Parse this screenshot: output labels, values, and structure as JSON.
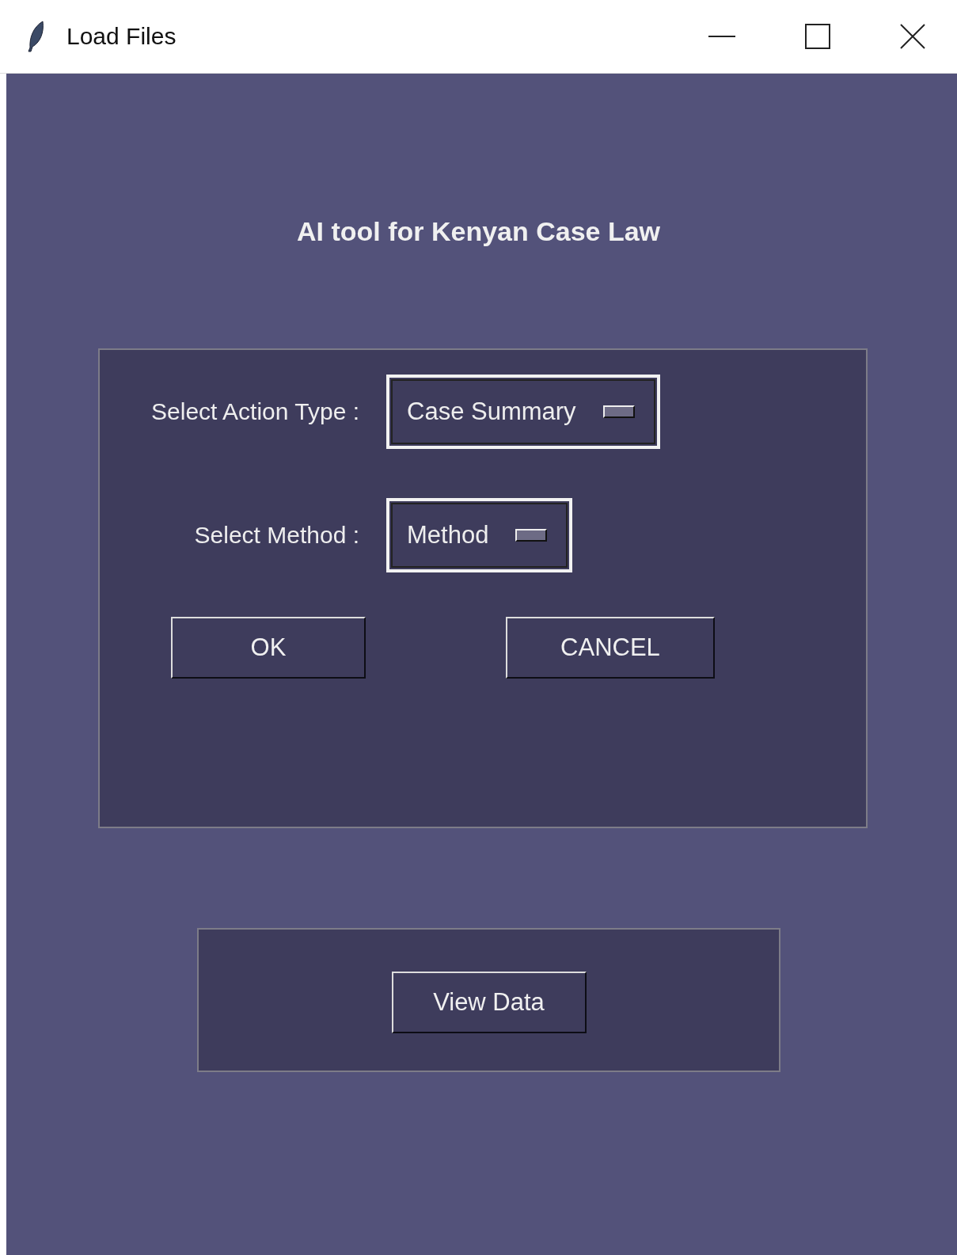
{
  "window": {
    "title": "Load Files"
  },
  "heading": "AI tool for Kenyan Case Law",
  "selects": [
    {
      "label": "Select Action Type :",
      "value": "Case Summary"
    },
    {
      "label": "Select Method :",
      "value": "Method"
    }
  ],
  "buttons": [
    {
      "label": "OK"
    },
    {
      "label": "CANCEL"
    }
  ],
  "view_button": "View Data"
}
